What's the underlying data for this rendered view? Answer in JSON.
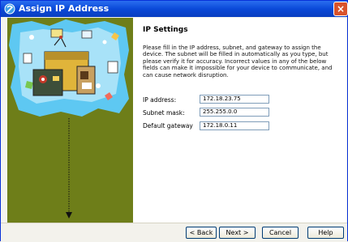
{
  "window": {
    "title": "Assign IP Address",
    "close_label": "×"
  },
  "content": {
    "heading": "IP Settings",
    "description": "Please fill in the IP address, subnet, and gateway to assign the device. The subnet will be filled in automatically as you type, but please verify it for accuracy.  Incorrect values in any of the below fields can make it impossible for your device to communicate, and can cause network disruption."
  },
  "fields": {
    "ip_address": {
      "label": "IP address:",
      "value": "172.18.23.75"
    },
    "subnet_mask": {
      "label": "Subnet mask:",
      "value": "255.255.0.0"
    },
    "default_gateway": {
      "label": "Default gateway",
      "value": "172.18.0.11"
    }
  },
  "buttons": {
    "back": "< Back",
    "next": "Next >",
    "cancel": "Cancel",
    "help": "Help"
  },
  "colors": {
    "titlebar": "#0a49d8",
    "side_panel": "#6e7e19",
    "close_button": "#d9532b"
  }
}
